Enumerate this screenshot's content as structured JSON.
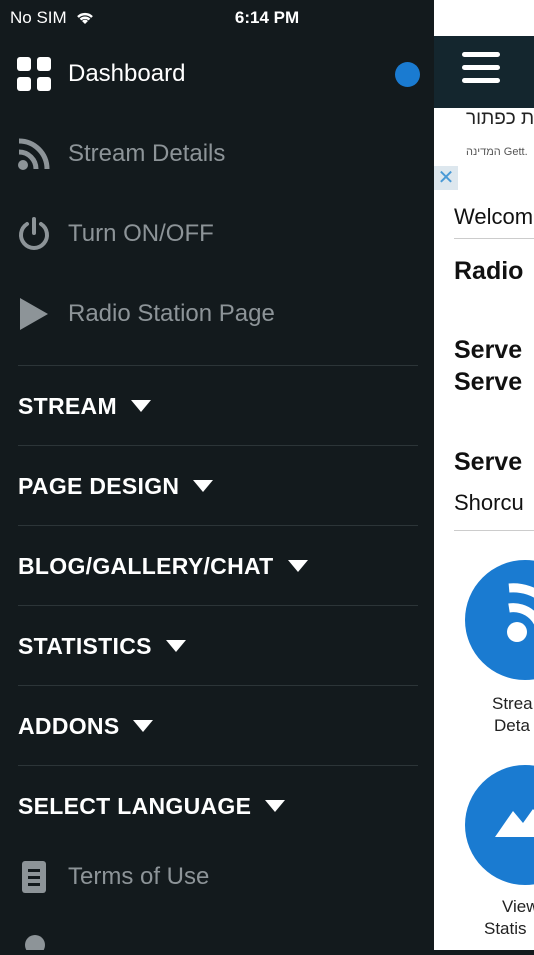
{
  "status_bar": {
    "carrier": "No SIM",
    "time": "6:14 PM",
    "battery_color": "#4cd964"
  },
  "drawer": {
    "items": [
      {
        "label": "Dashboard",
        "icon": "dashboard-grid-icon",
        "active": true
      },
      {
        "label": "Stream Details",
        "icon": "rss-icon"
      },
      {
        "label": "Turn ON/OFF",
        "icon": "power-icon"
      },
      {
        "label": "Radio Station Page",
        "icon": "play-icon"
      }
    ],
    "sections": [
      {
        "label": "STREAM"
      },
      {
        "label": "PAGE DESIGN"
      },
      {
        "label": "BLOG/GALLERY/CHAT"
      },
      {
        "label": "STATISTICS"
      },
      {
        "label": "ADDONS"
      },
      {
        "label": "SELECT LANGUAGE"
      }
    ],
    "footer_items": [
      {
        "label": "Terms of Use",
        "icon": "document-icon"
      }
    ],
    "accent": "#1a7bd1"
  },
  "content": {
    "ad_title": "ת כפתור",
    "ad_sub": "המדינה Gett.",
    "welcome": "Welcom",
    "radio": "Radio",
    "server1": "Serve",
    "server2": "Serve",
    "server3": "Serve",
    "shortcut": "Shorcu",
    "shortcut1_line1": "Strea",
    "shortcut1_line2": "Deta",
    "shortcut2_line1": "View",
    "shortcut2_line2": "Statis"
  }
}
